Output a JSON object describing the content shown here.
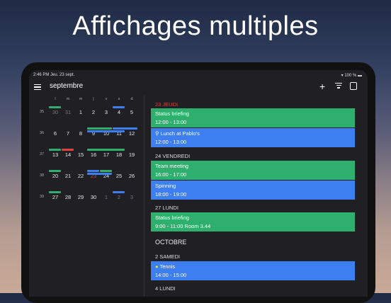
{
  "headline": "Affichages multiples",
  "status": {
    "time": "2:46 PM",
    "date": "Jeu. 23 sept.",
    "battery": "100 %"
  },
  "toolbar": {
    "month": "septembre",
    "icons": [
      "menu-icon",
      "plus-icon",
      "filter-icon",
      "calendar-icon"
    ]
  },
  "calendar": {
    "weekdays": [
      "l",
      "m",
      "m",
      "j",
      "v",
      "s",
      "d"
    ],
    "weeks": [
      {
        "num": "35",
        "days": [
          {
            "d": "30",
            "dim": true
          },
          {
            "d": "31",
            "dim": true
          },
          {
            "d": "1"
          },
          {
            "d": "2"
          },
          {
            "d": "3"
          },
          {
            "d": "4"
          },
          {
            "d": "5"
          }
        ]
      },
      {
        "num": "36",
        "days": [
          {
            "d": "6"
          },
          {
            "d": "7"
          },
          {
            "d": "8"
          },
          {
            "d": "9"
          },
          {
            "d": "10"
          },
          {
            "d": "11"
          },
          {
            "d": "12"
          }
        ]
      },
      {
        "num": "37",
        "days": [
          {
            "d": "13"
          },
          {
            "d": "14"
          },
          {
            "d": "15"
          },
          {
            "d": "16"
          },
          {
            "d": "17"
          },
          {
            "d": "18"
          },
          {
            "d": "19"
          }
        ]
      },
      {
        "num": "38",
        "days": [
          {
            "d": "20"
          },
          {
            "d": "21"
          },
          {
            "d": "22"
          },
          {
            "d": "23",
            "red": true
          },
          {
            "d": "24"
          },
          {
            "d": "25"
          },
          {
            "d": "26"
          }
        ]
      },
      {
        "num": "39",
        "days": [
          {
            "d": "27"
          },
          {
            "d": "28"
          },
          {
            "d": "29"
          },
          {
            "d": "30"
          },
          {
            "d": "1",
            "dim": true
          },
          {
            "d": "2",
            "dim": true
          },
          {
            "d": "3",
            "dim": true
          }
        ]
      }
    ]
  },
  "agenda": {
    "day1": "23 JEUDI",
    "ev1": {
      "title": "Status briefing",
      "time": "12:00 - 13:00"
    },
    "ev2": {
      "title": "Lunch at Pablo's",
      "time": "12:00 - 13:00"
    },
    "day2": "24 VENDREDI",
    "ev3": {
      "title": "Team meeting",
      "time": "16:00 - 17:00"
    },
    "ev4": {
      "title": "Spinning",
      "time": "18:00 - 19:00"
    },
    "day3": "27 LUNDI",
    "ev5": {
      "title": "Status briefing",
      "time": "9:00 - 11:00 Room 3.44"
    },
    "month2": "OCTOBRE",
    "day4": "2 SAMEDI",
    "ev6": {
      "title": "Tennis",
      "time": "14:00 - 15:00"
    },
    "day5": "4 LUNDI"
  },
  "colors": {
    "green": "#2eaf6e",
    "blue": "#3d7ef0",
    "red": "#e0413a"
  }
}
